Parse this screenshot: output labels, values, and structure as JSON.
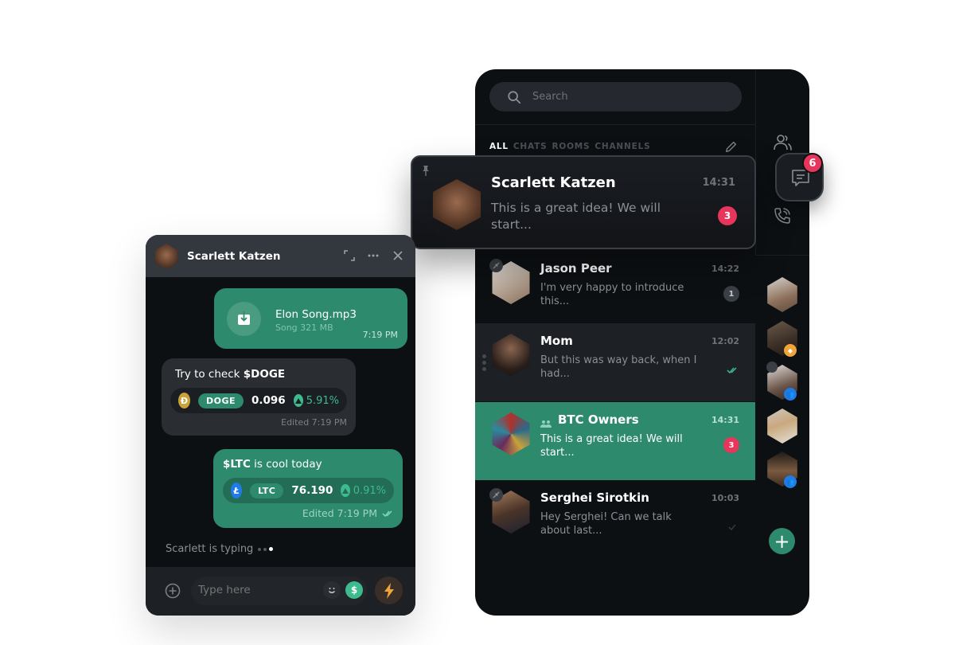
{
  "colors": {
    "accent_green": "#2e8a6d",
    "badge_red": "#e8355c",
    "panel_bg": "#0d1013",
    "bubble_dark": "#2a2d32",
    "positive": "#3dbb8f",
    "ltc_blue": "#1e7be8",
    "group_blue": "#1e7be8",
    "bolt_orange": "#f0a43a"
  },
  "search": {
    "placeholder": "Search",
    "icon": "search-icon"
  },
  "filters": [
    {
      "label": "ALL",
      "active": true
    },
    {
      "label": "CHATS",
      "active": false
    },
    {
      "label": "ROOMS",
      "active": false
    },
    {
      "label": "CHANNELS",
      "active": false
    }
  ],
  "rail": {
    "icons": [
      "people-icon",
      "chat-icon",
      "calls-icon"
    ],
    "chat_badge": "6",
    "add_label": "+"
  },
  "pinned_chat": {
    "name": "Scarlett Katzen",
    "time": "14:31",
    "preview": "This is a great idea! We will start...",
    "unread": "3",
    "pinned": true
  },
  "chats": [
    {
      "name": "Jason Peer",
      "time": "14:22",
      "preview": "I'm very happy to introduce this...",
      "unread": "1",
      "muted": true,
      "status": "unread-gray"
    },
    {
      "name": "Mom",
      "time": "12:02",
      "preview": "But this was way back, when I had...",
      "status": "read-double-check"
    },
    {
      "name": "BTC Owners",
      "time": "14:31",
      "preview": "This is a great idea! We will start...",
      "unread": "3",
      "group": true,
      "selected": true
    },
    {
      "name": "Serghei Sirotkin",
      "time": "10:03",
      "preview": "Hey Serghei! Can we talk about last...",
      "muted": true,
      "status": "sent-check"
    }
  ],
  "chat_window": {
    "title": "Scarlett Katzen",
    "header_icons": [
      "expand-icon",
      "more-icon",
      "close-icon"
    ],
    "messages": [
      {
        "type": "file",
        "direction": "out",
        "filename": "Elon Song.mp3",
        "meta": "Song 321 MB",
        "time": "7:19 PM"
      },
      {
        "type": "ticker",
        "direction": "in",
        "text_prefix": "Try to check ",
        "text_bold": "$DOGE",
        "text_suffix": "",
        "symbol": "DOGE",
        "price": "0.096",
        "change": "5.91%",
        "footer": "Edited 7:19 PM"
      },
      {
        "type": "ticker",
        "direction": "out",
        "text_prefix": "",
        "text_bold": "$LTC",
        "text_suffix": " is cool today",
        "symbol": "LTC",
        "price": "76.190",
        "change": "0.91%",
        "footer": "Edited 7:19 PM"
      }
    ],
    "typing": "Scarlett is typing",
    "composer": {
      "placeholder": "Type here"
    }
  }
}
